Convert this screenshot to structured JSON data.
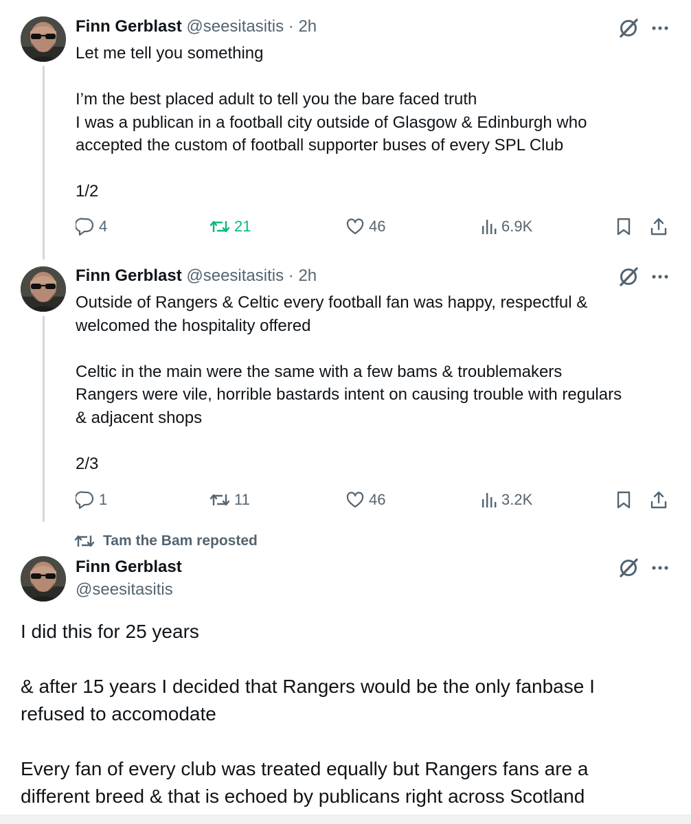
{
  "tweets": [
    {
      "name": "Finn Gerblast",
      "handle": "@seesitasitis",
      "separator": "·",
      "time": "2h",
      "lines": [
        "Let me tell you something",
        "",
        "I’m the best placed adult to tell you the bare faced truth",
        "I was a publican in a football city outside of Glasgow & Edinburgh who",
        "accepted the custom of football supporter buses of every SPL Club",
        "",
        "1/2"
      ],
      "replies": "4",
      "reposts": "21",
      "likes": "46",
      "views": "6.9K",
      "reposted_by_viewer": true
    },
    {
      "name": "Finn Gerblast",
      "handle": "@seesitasitis",
      "separator": "·",
      "time": "2h",
      "lines": [
        "Outside of Rangers & Celtic every football fan was happy, respectful &",
        "welcomed the hospitality offered",
        "",
        "Celtic in the main were the same with a few bams & troublemakers",
        "Rangers were vile, horrible bastards intent on causing trouble with regulars",
        "& adjacent shops",
        "",
        "2/3"
      ],
      "replies": "1",
      "reposts": "11",
      "likes": "46",
      "views": "3.2K",
      "reposted_by_viewer": false
    },
    {
      "repost_label": "Tam the Bam reposted",
      "name": "Finn Gerblast",
      "handle": "@seesitasitis",
      "lines": [
        "I did this for 25 years",
        "",
        "& after 15 years I decided that Rangers would be the only fanbase I",
        "refused to accomodate",
        "",
        "Every fan of every club  was treated equally but Rangers fans are a",
        "different breed & that is echoed by publicans right across Scotland"
      ]
    }
  ],
  "colors": {
    "text": "#0f1419",
    "secondary": "#536471",
    "repost_active": "#00ba7c",
    "thread_line": "#cfd9de"
  },
  "icons": [
    "grok-icon",
    "more-icon",
    "reply-icon",
    "repost-icon",
    "like-icon",
    "views-icon",
    "bookmark-icon",
    "share-icon"
  ]
}
